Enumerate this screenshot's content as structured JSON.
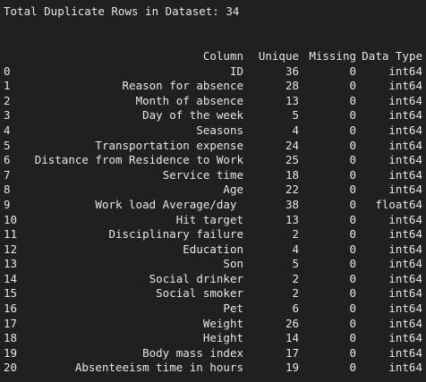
{
  "summary": {
    "text": "Total Duplicate Rows in Dataset: 34"
  },
  "table": {
    "headers": [
      "Column",
      "Unique",
      "Missing",
      "Data Type"
    ],
    "rows": [
      {
        "index": "0",
        "column": "ID",
        "unique": "36",
        "missing": "0",
        "dtype": "int64"
      },
      {
        "index": "1",
        "column": "Reason for absence",
        "unique": "28",
        "missing": "0",
        "dtype": "int64"
      },
      {
        "index": "2",
        "column": "Month of absence",
        "unique": "13",
        "missing": "0",
        "dtype": "int64"
      },
      {
        "index": "3",
        "column": "Day of the week",
        "unique": "5",
        "missing": "0",
        "dtype": "int64"
      },
      {
        "index": "4",
        "column": "Seasons",
        "unique": "4",
        "missing": "0",
        "dtype": "int64"
      },
      {
        "index": "5",
        "column": "Transportation expense",
        "unique": "24",
        "missing": "0",
        "dtype": "int64"
      },
      {
        "index": "6",
        "column": "Distance from Residence to Work",
        "unique": "25",
        "missing": "0",
        "dtype": "int64"
      },
      {
        "index": "7",
        "column": "Service time",
        "unique": "18",
        "missing": "0",
        "dtype": "int64"
      },
      {
        "index": "8",
        "column": "Age",
        "unique": "22",
        "missing": "0",
        "dtype": "int64"
      },
      {
        "index": "9",
        "column": "Work load Average/day ",
        "unique": "38",
        "missing": "0",
        "dtype": "float64"
      },
      {
        "index": "10",
        "column": "Hit target",
        "unique": "13",
        "missing": "0",
        "dtype": "int64"
      },
      {
        "index": "11",
        "column": "Disciplinary failure",
        "unique": "2",
        "missing": "0",
        "dtype": "int64"
      },
      {
        "index": "12",
        "column": "Education",
        "unique": "4",
        "missing": "0",
        "dtype": "int64"
      },
      {
        "index": "13",
        "column": "Son",
        "unique": "5",
        "missing": "0",
        "dtype": "int64"
      },
      {
        "index": "14",
        "column": "Social drinker",
        "unique": "2",
        "missing": "0",
        "dtype": "int64"
      },
      {
        "index": "15",
        "column": "Social smoker",
        "unique": "2",
        "missing": "0",
        "dtype": "int64"
      },
      {
        "index": "16",
        "column": "Pet",
        "unique": "6",
        "missing": "0",
        "dtype": "int64"
      },
      {
        "index": "17",
        "column": "Weight",
        "unique": "26",
        "missing": "0",
        "dtype": "int64"
      },
      {
        "index": "18",
        "column": "Height",
        "unique": "14",
        "missing": "0",
        "dtype": "int64"
      },
      {
        "index": "19",
        "column": "Body mass index",
        "unique": "17",
        "missing": "0",
        "dtype": "int64"
      },
      {
        "index": "20",
        "column": "Absenteeism time in hours",
        "unique": "19",
        "missing": "0",
        "dtype": "int64"
      }
    ]
  }
}
